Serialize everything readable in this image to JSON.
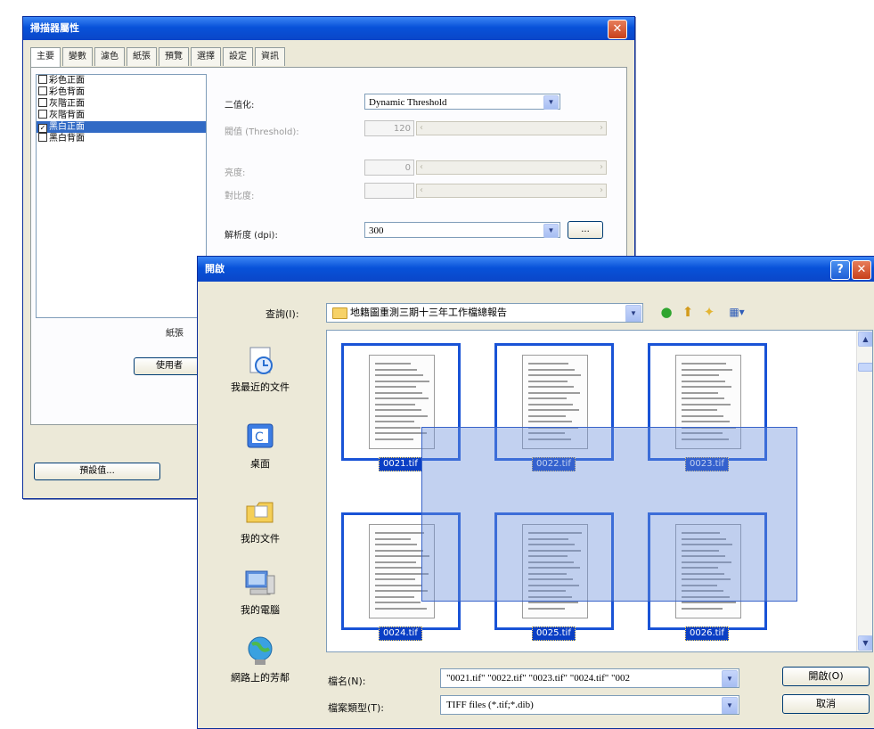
{
  "scanner_dialog": {
    "title": "掃描器屬性",
    "tabs": [
      "主要",
      "變數",
      "濾色",
      "紙張",
      "預覽",
      "選擇",
      "設定",
      "資訊"
    ],
    "sides": [
      {
        "label": "彩色正面",
        "checked": false,
        "selected": false
      },
      {
        "label": "彩色背面",
        "checked": false,
        "selected": false
      },
      {
        "label": "灰階正面",
        "checked": false,
        "selected": false
      },
      {
        "label": "灰階背面",
        "checked": false,
        "selected": false
      },
      {
        "label": "黑白正面",
        "checked": true,
        "selected": true
      },
      {
        "label": "黑白背面",
        "checked": false,
        "selected": false
      }
    ],
    "binarize_label": "二值化:",
    "binarize_value": "Dynamic Threshold",
    "threshold_label": "閥值 (Threshold):",
    "threshold_value": "120",
    "brightness_label": "亮度:",
    "brightness_value": "0",
    "contrast_label": "對比度:",
    "contrast_value": "",
    "resolution_label": "解析度 (dpi):",
    "resolution_value": "300",
    "ellipsis_button": "...",
    "paper_label": "紙張",
    "use_button": "使用者",
    "preset_button": "預設值..."
  },
  "open_dialog": {
    "title": "開啟",
    "lookin_label": "查詢(I):",
    "lookin_value": "地籍圖重測三期十三年工作檔總報告",
    "places": [
      {
        "label": "我最近的文件",
        "icon": "recent-documents-icon"
      },
      {
        "label": "桌面",
        "icon": "desktop-icon"
      },
      {
        "label": "我的文件",
        "icon": "my-documents-icon"
      },
      {
        "label": "我的電腦",
        "icon": "my-computer-icon"
      },
      {
        "label": "網路上的芳鄰",
        "icon": "network-places-icon"
      }
    ],
    "files": [
      "0021.tif",
      "0022.tif",
      "0023.tif",
      "0024.tif",
      "0025.tif",
      "0026.tif"
    ],
    "filename_label": "檔名(N):",
    "filename_value": "\"0021.tif\" \"0022.tif\" \"0023.tif\" \"0024.tif\" \"002",
    "filetype_label": "檔案類型(T):",
    "filetype_value": "TIFF files (*.tif;*.dib)",
    "open_button": "開啟(O)",
    "cancel_button": "取消"
  },
  "colors": {
    "title_blue": "#0852d9",
    "selection_blue": "#1953d6",
    "dialog_face": "#ece9d8"
  }
}
